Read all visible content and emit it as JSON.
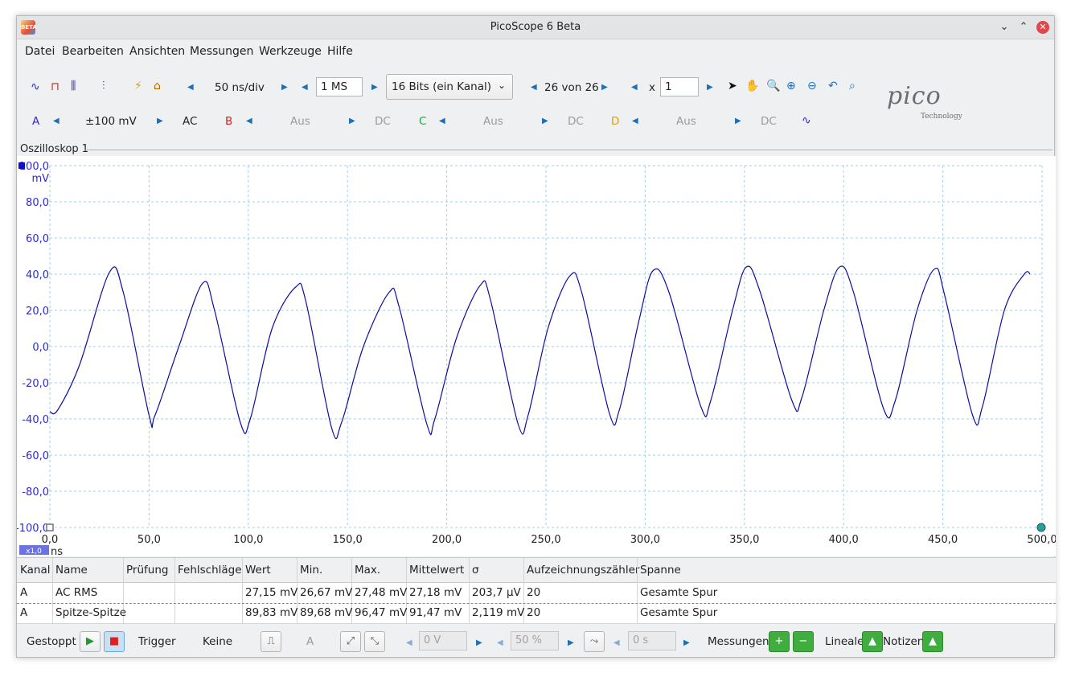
{
  "window": {
    "title": "PicoScope 6 Beta",
    "app_icon_text": "BETA"
  },
  "menu": [
    "Datei",
    "Bearbeiten",
    "Ansichten",
    "Messungen",
    "Werkzeuge",
    "Hilfe"
  ],
  "toolbar": {
    "timebase": "50 ns/div",
    "samples": "1 MS",
    "resolution": "16 Bits (ein Kanal)",
    "buffer": "26 von 26",
    "zoom_prefix": "x",
    "zoom_value": "1",
    "logo_word": "pico",
    "logo_sub": "Technology"
  },
  "channels": [
    {
      "letter": "A",
      "color": "#2a2ad8",
      "range": "±100 mV",
      "coupling": "AC",
      "enabled": true
    },
    {
      "letter": "B",
      "color": "#e02020",
      "range": "Aus",
      "coupling": "DC",
      "enabled": false
    },
    {
      "letter": "C",
      "color": "#17a64a",
      "range": "Aus",
      "coupling": "DC",
      "enabled": false
    },
    {
      "letter": "D",
      "color": "#d4a017",
      "range": "Aus",
      "coupling": "DC",
      "enabled": false
    }
  ],
  "scope": {
    "tab_label": "Oszilloskop 1",
    "x_zoom_badge": "x1,0",
    "x_unit": "ns",
    "y_unit": "mV"
  },
  "chart_data": {
    "type": "line",
    "title": "",
    "xlabel": "ns",
    "ylabel": "mV",
    "xlim": [
      0,
      500
    ],
    "ylim": [
      -100,
      100
    ],
    "x_ticks": [
      "0,0",
      "50,0",
      "100,0",
      "150,0",
      "200,0",
      "250,0",
      "300,0",
      "350,0",
      "400,0",
      "450,0",
      "500,0"
    ],
    "y_ticks": [
      "100,0",
      "80,0",
      "60,0",
      "40,0",
      "20,0",
      "0,0",
      "-20,0",
      "-40,0",
      "-60,0",
      "-80,0",
      "-100,0"
    ],
    "grid": true,
    "series": [
      {
        "channel": "A",
        "color": "#0d0d9c",
        "x": [
          0,
          4,
          15,
          30,
          37,
          50,
          53,
          65,
          77,
          83,
          96,
          101,
          112,
          124,
          129,
          142,
          147,
          158,
          171,
          176,
          190,
          194,
          205,
          217,
          222,
          236,
          241,
          251,
          262,
          268,
          282,
          287,
          297,
          304,
          312,
          328,
          333,
          344,
          351,
          358,
          374,
          379,
          390,
          398,
          405,
          420,
          426,
          437,
          446,
          451,
          465,
          470,
          481,
          491,
          494
        ],
        "y": [
          -36,
          -35,
          -10,
          41,
          30,
          -38,
          -38,
          0,
          35,
          20,
          -42,
          -40,
          10,
          33,
          25,
          -45,
          -42,
          0,
          30,
          22,
          -43,
          -40,
          5,
          34,
          26,
          -43,
          -38,
          10,
          39,
          30,
          -37,
          -35,
          15,
          42,
          30,
          -33,
          -30,
          20,
          44,
          30,
          -30,
          -28,
          20,
          44,
          30,
          -34,
          -30,
          20,
          43,
          28,
          -38,
          -33,
          20,
          40,
          40
        ]
      }
    ],
    "annotations": [
      "Kanal-A-Markierung oben links",
      "Triggermarkierung unten rechts"
    ]
  },
  "measurements": {
    "headers": [
      "Kanal",
      "Name",
      "Prüfung",
      "Fehlschläge",
      "Wert",
      "Min.",
      "Max.",
      "Mittelwert",
      "σ",
      "Aufzeichnungszähler",
      "Spanne"
    ],
    "rows": [
      [
        "A",
        "AC RMS",
        "",
        "",
        "27,15 mV",
        "26,67 mV",
        "27,48 mV",
        "27,18 mV",
        "203,7 µV",
        "20",
        "Gesamte Spur"
      ],
      [
        "A",
        "Spitze-Spitze",
        "",
        "",
        "89,83 mV",
        "89,68 mV",
        "96,47 mV",
        "91,47 mV",
        "2,119 mV",
        "20",
        "Gesamte Spur"
      ]
    ]
  },
  "statusbar": {
    "state": "Gestoppt",
    "trigger_label": "Trigger",
    "trigger_mode": "Keine",
    "trigger_channel": "A",
    "threshold": "0 V",
    "pretrigger": "50 %",
    "delay": "0 s",
    "measurements_label": "Messungen",
    "rulers_label": "Lineale",
    "notes_label": "Notizen"
  }
}
